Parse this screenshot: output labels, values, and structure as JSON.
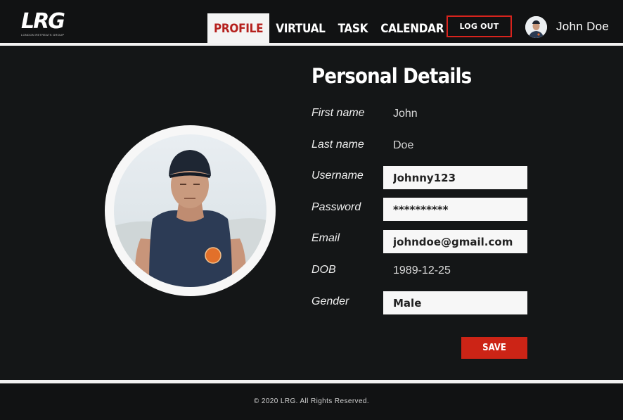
{
  "header": {
    "logo": {
      "mark": "LRG",
      "subtitle": "LONDON RETREATS GROUP"
    },
    "nav": [
      {
        "label": "PROFILE",
        "active": true
      },
      {
        "label": "VIRTUAL",
        "active": false
      },
      {
        "label": "TASK",
        "active": false
      },
      {
        "label": "CALENDAR",
        "active": false
      }
    ],
    "logout_label": "LOG OUT",
    "user_name": "John Doe"
  },
  "profile": {
    "title": "Personal Details",
    "fields": {
      "first_name": {
        "label": "First name",
        "value": "John"
      },
      "last_name": {
        "label": "Last name",
        "value": "Doe"
      },
      "username": {
        "label": "Username",
        "value": "Johnny123"
      },
      "password": {
        "label": "Password",
        "value": "**********"
      },
      "email": {
        "label": "Email",
        "value": "johndoe@gmail.com"
      },
      "dob": {
        "label": "DOB",
        "value": "1989-12-25"
      },
      "gender": {
        "label": "Gender",
        "value": "Male"
      }
    },
    "save_label": "SAVE"
  },
  "footer": {
    "copyright": "© 2020 LRG.  All Rights Reserved."
  },
  "colors": {
    "accent": "#cc2416",
    "background": "#141617",
    "header": "#111213"
  }
}
